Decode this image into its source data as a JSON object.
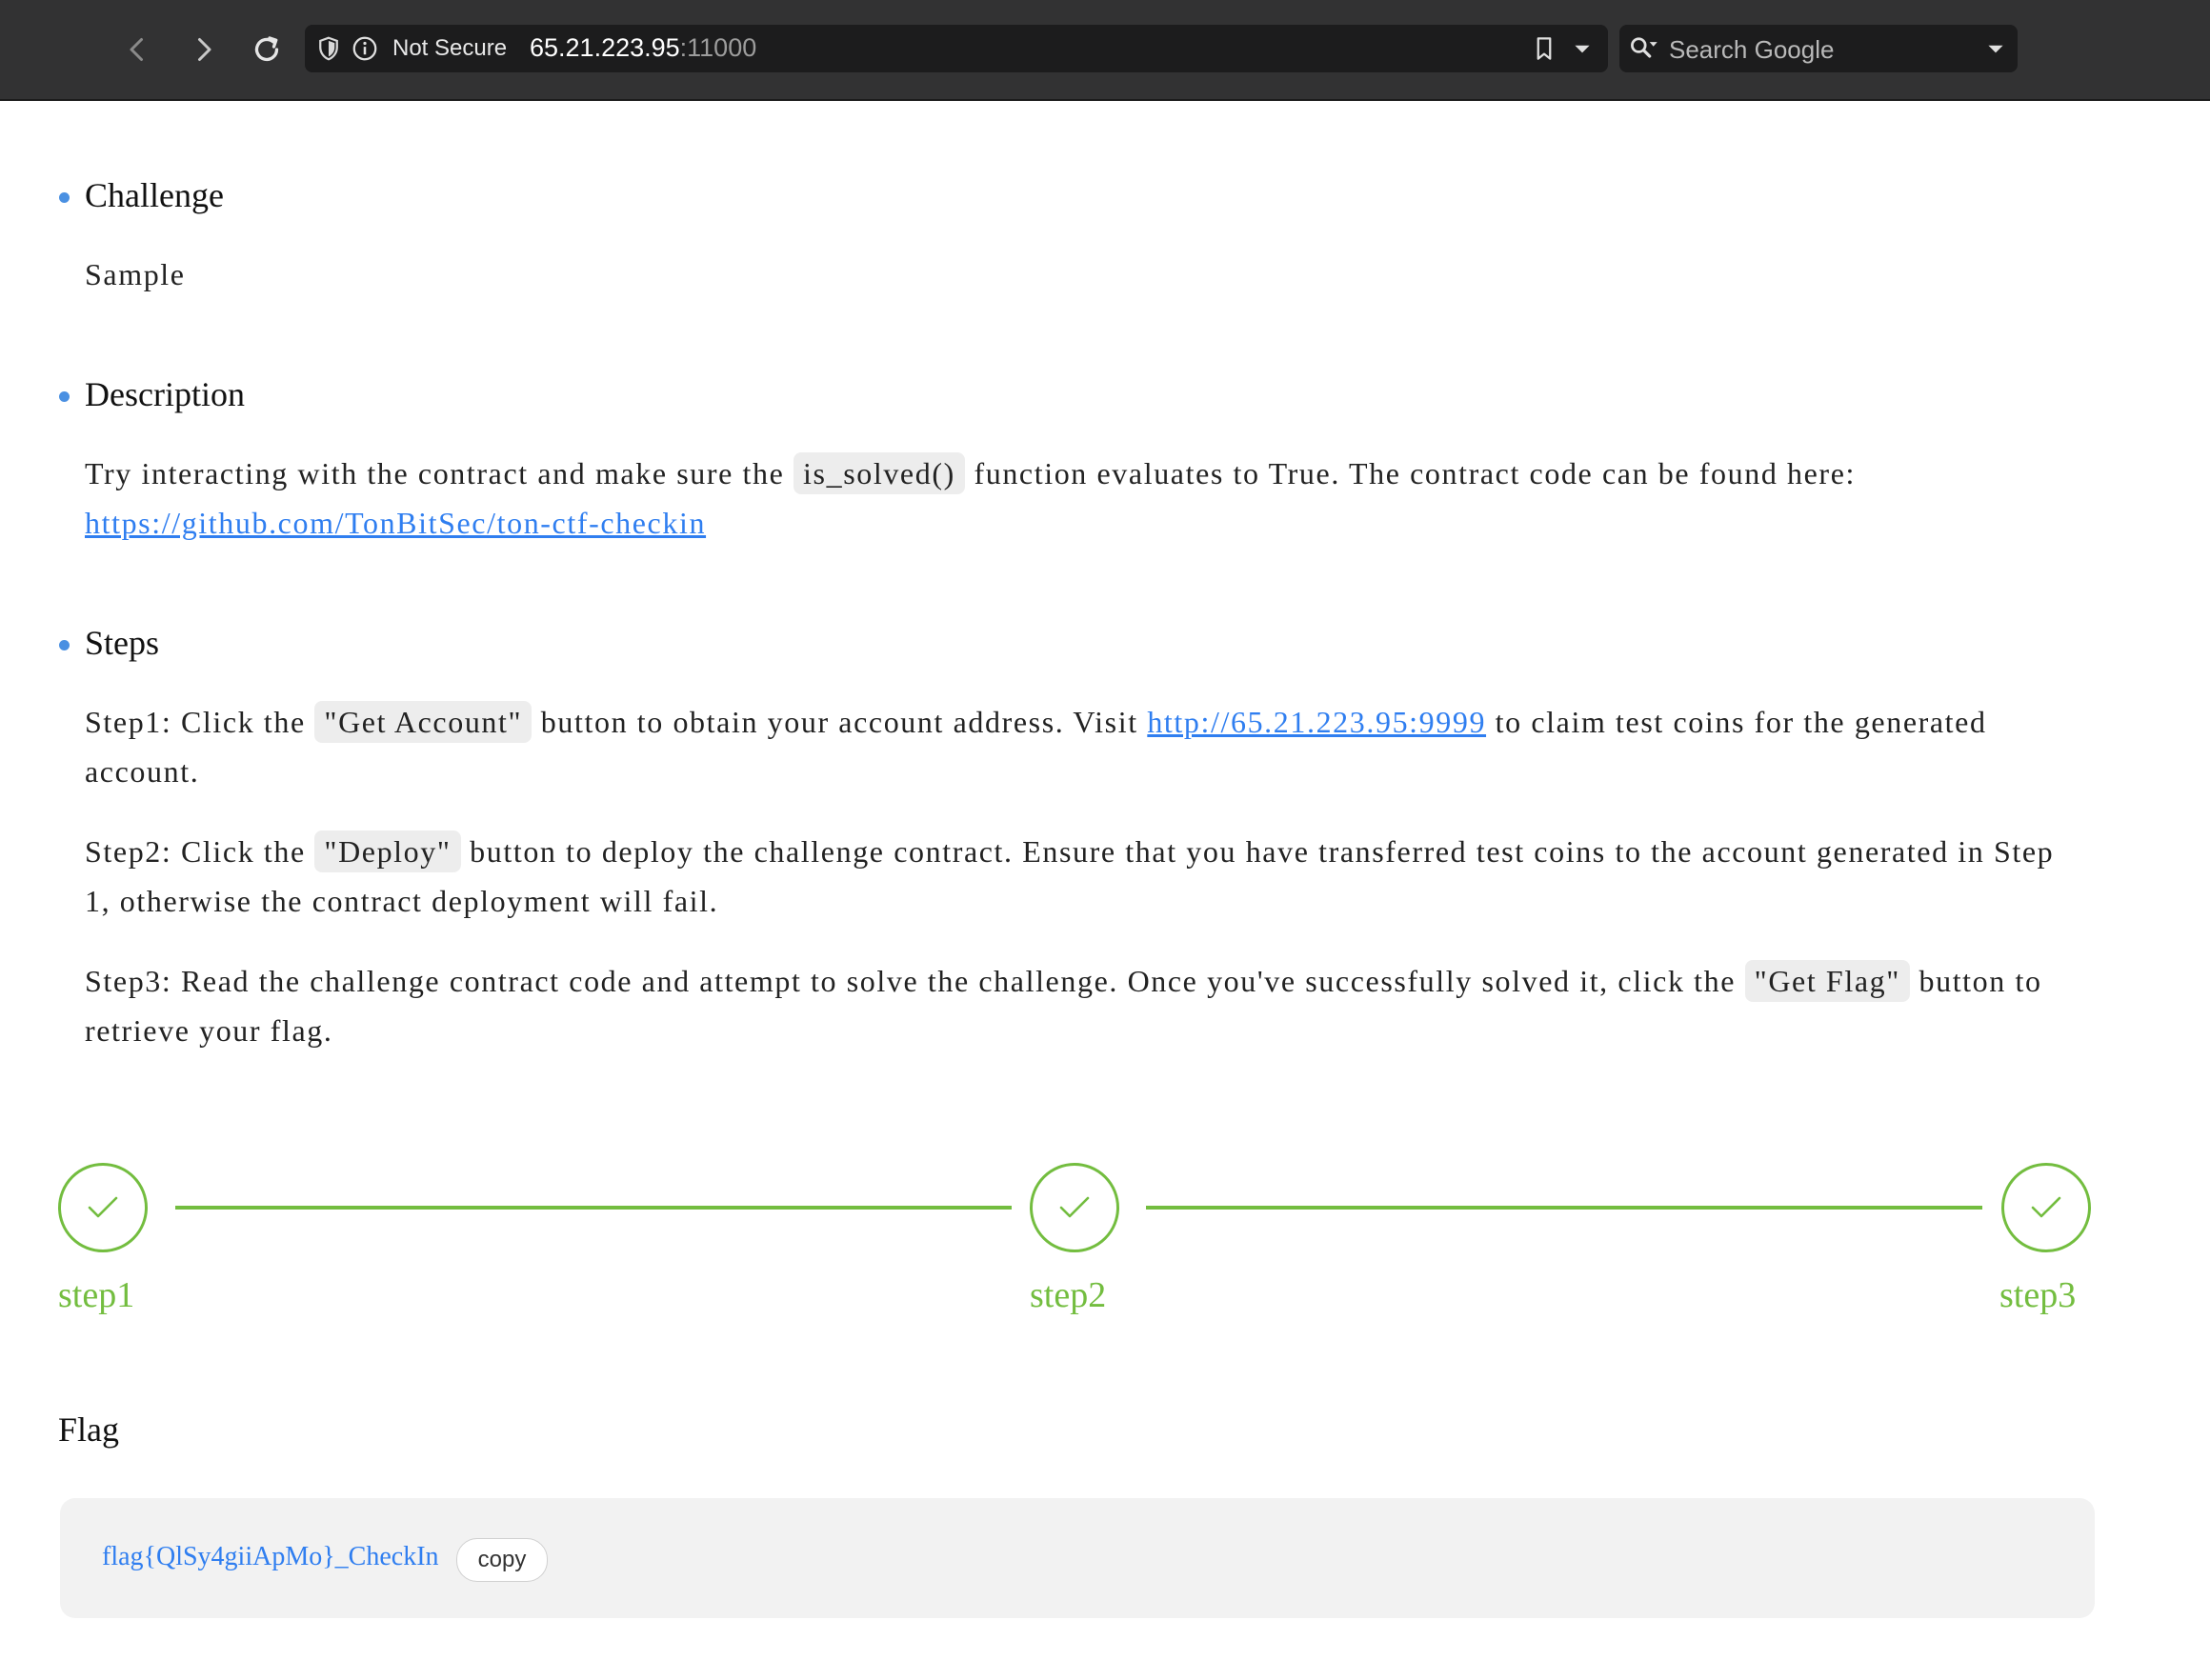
{
  "browser": {
    "security_label": "Not Secure",
    "url_host": "65.21.223.95",
    "url_port": ":11000",
    "search_placeholder": "Search Google"
  },
  "challenge": {
    "heading": "Challenge",
    "name": "Sample"
  },
  "description": {
    "heading": "Description",
    "text_before_code": "Try interacting with the contract and make sure the ",
    "code": "is_solved()",
    "text_after_code": " function evaluates to True. The contract code can be found here:",
    "link": "https://github.com/TonBitSec/ton-ctf-checkin"
  },
  "steps_section": {
    "heading": "Steps",
    "step1": {
      "prefix": "Step1: Click the ",
      "code": "\"Get Account\"",
      "middle": " button to obtain your account address. Visit ",
      "link": "http://65.21.223.95:9999",
      "suffix": " to claim test coins for the generated account."
    },
    "step2": {
      "prefix": "Step2: Click the ",
      "code": "\"Deploy\"",
      "suffix": " button to deploy the challenge contract. Ensure that you have transferred test coins to the account generated in Step 1, otherwise the contract deployment will fail."
    },
    "step3": {
      "prefix": "Step3: Read the challenge contract code and attempt to solve the challenge. Once you've successfully solved it, click the ",
      "code": "\"Get Flag\"",
      "suffix": " button to retrieve your flag."
    }
  },
  "progress": {
    "steps": [
      "step1",
      "step2",
      "step3"
    ],
    "completed": 3
  },
  "flag": {
    "heading": "Flag",
    "value": "flag{QlSy4giiApMo}_CheckIn",
    "copy_label": "copy"
  },
  "colors": {
    "accent_blue": "#4a90e2",
    "link_blue": "#2f7ef0",
    "success_green": "#73bd3f"
  }
}
